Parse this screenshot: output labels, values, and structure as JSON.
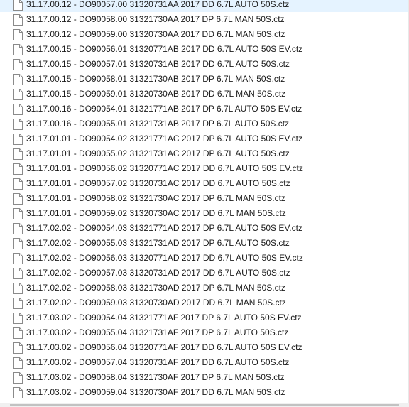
{
  "files": [
    {
      "name": "31.17.00.12 - DO90057.00 31320731AA 2017 DD 6.7L AUTO 50S.ctz",
      "icon": "document-icon"
    },
    {
      "name": "31.17.00.12 - DO90058.00 31321730AA 2017 DP 6.7L MAN 50S.ctz",
      "icon": "document-icon"
    },
    {
      "name": "31.17.00.12 - DO90059.00 31320730AA 2017 DD 6.7L MAN 50S.ctz",
      "icon": "document-icon"
    },
    {
      "name": "31.17.00.15 - DO90056.01 31320771AB 2017 DD 6.7L AUTO 50S EV.ctz",
      "icon": "document-icon"
    },
    {
      "name": "31.17.00.15 - DO90057.01 31320731AB 2017 DD 6.7L AUTO 50S.ctz",
      "icon": "document-icon"
    },
    {
      "name": "31.17.00.15 - DO90058.01 31321730AB 2017 DP 6.7L MAN 50S.ctz",
      "icon": "document-icon"
    },
    {
      "name": "31.17.00.15 - DO90059.01 31320730AB 2017 DD 6.7L MAN 50S.ctz",
      "icon": "document-icon"
    },
    {
      "name": "31.17.00.16 - DO90054.01 31321771AB 2017 DP 6.7L AUTO 50S EV.ctz",
      "icon": "document-icon"
    },
    {
      "name": "31.17.00.16 - DO90055.01 31321731AB 2017 DP 6.7L AUTO 50S.ctz",
      "icon": "document-icon"
    },
    {
      "name": "31.17.01.01 - DO90054.02 31321771AC 2017 DP 6.7L AUTO 50S EV.ctz",
      "icon": "document-icon"
    },
    {
      "name": "31.17.01.01 - DO90055.02 31321731AC 2017 DP 6.7L AUTO 50S.ctz",
      "icon": "document-icon"
    },
    {
      "name": "31.17.01.01 - DO90056.02 31320771AC 2017 DD 6.7L AUTO 50S EV.ctz",
      "icon": "document-icon"
    },
    {
      "name": "31.17.01.01 - DO90057.02 31320731AC 2017 DD 6.7L AUTO 50S.ctz",
      "icon": "document-icon"
    },
    {
      "name": "31.17.01.01 - DO90058.02 31321730AC 2017 DP 6.7L MAN 50S.ctz",
      "icon": "document-icon"
    },
    {
      "name": "31.17.01.01 - DO90059.02 31320730AC 2017 DD 6.7L MAN 50S.ctz",
      "icon": "document-icon"
    },
    {
      "name": "31.17.02.02 - DO90054.03 31321771AD 2017 DP 6.7L AUTO 50S EV.ctz",
      "icon": "document-icon"
    },
    {
      "name": "31.17.02.02 - DO90055.03 31321731AD 2017 DP 6.7L AUTO 50S.ctz",
      "icon": "document-icon"
    },
    {
      "name": "31.17.02.02 - DO90056.03 31320771AD 2017 DD 6.7L AUTO 50S EV.ctz",
      "icon": "document-icon"
    },
    {
      "name": "31.17.02.02 - DO90057.03 31320731AD 2017 DD 6.7L AUTO 50S.ctz",
      "icon": "document-icon"
    },
    {
      "name": "31.17.02.02 - DO90058.03 31321730AD 2017 DP 6.7L MAN 50S.ctz",
      "icon": "document-icon"
    },
    {
      "name": "31.17.02.02 - DO90059.03 31320730AD 2017 DD 6.7L MAN 50S.ctz",
      "icon": "document-icon"
    },
    {
      "name": "31.17.03.02 - DO90054.04 31321771AF 2017 DP 6.7L AUTO 50S EV.ctz",
      "icon": "document-icon"
    },
    {
      "name": "31.17.03.02 - DO90055.04 31321731AF 2017 DP 6.7L AUTO 50S.ctz",
      "icon": "document-icon"
    },
    {
      "name": "31.17.03.02 - DO90056.04 31320771AF 2017 DD 6.7L AUTO 50S EV.ctz",
      "icon": "document-icon"
    },
    {
      "name": "31.17.03.02 - DO90057.04 31320731AF 2017 DD 6.7L AUTO 50S.ctz",
      "icon": "document-icon"
    },
    {
      "name": "31.17.03.02 - DO90058.04 31321730AF 2017 DP 6.7L MAN 50S.ctz",
      "icon": "document-icon"
    },
    {
      "name": "31.17.03.02 - DO90059.04 31320730AF 2017 DD 6.7L MAN 50S.ctz",
      "icon": "document-icon"
    }
  ]
}
